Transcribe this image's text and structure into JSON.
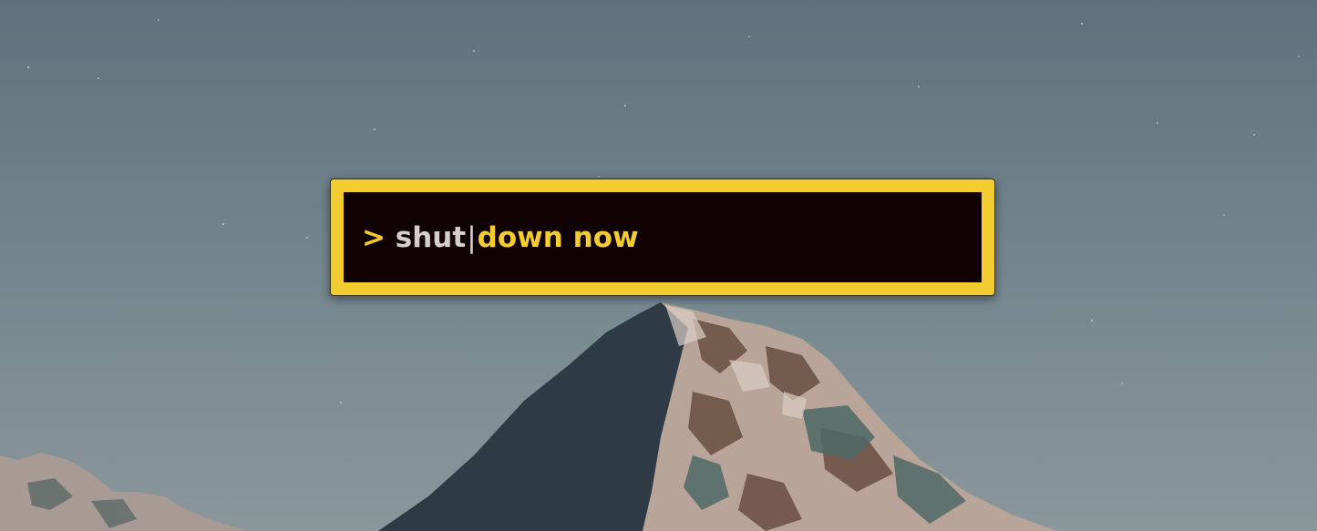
{
  "wallpaper": {
    "subject": "snowy-mountain-peak-under-night-sky"
  },
  "launcher": {
    "prompt": ">",
    "typed_text": "shut",
    "caret": "|",
    "completion": "down now",
    "colors": {
      "border": "#f2cc30",
      "background": "#100202",
      "typed_text": "#d4cfcc",
      "accent_text": "#f2cc30"
    }
  }
}
